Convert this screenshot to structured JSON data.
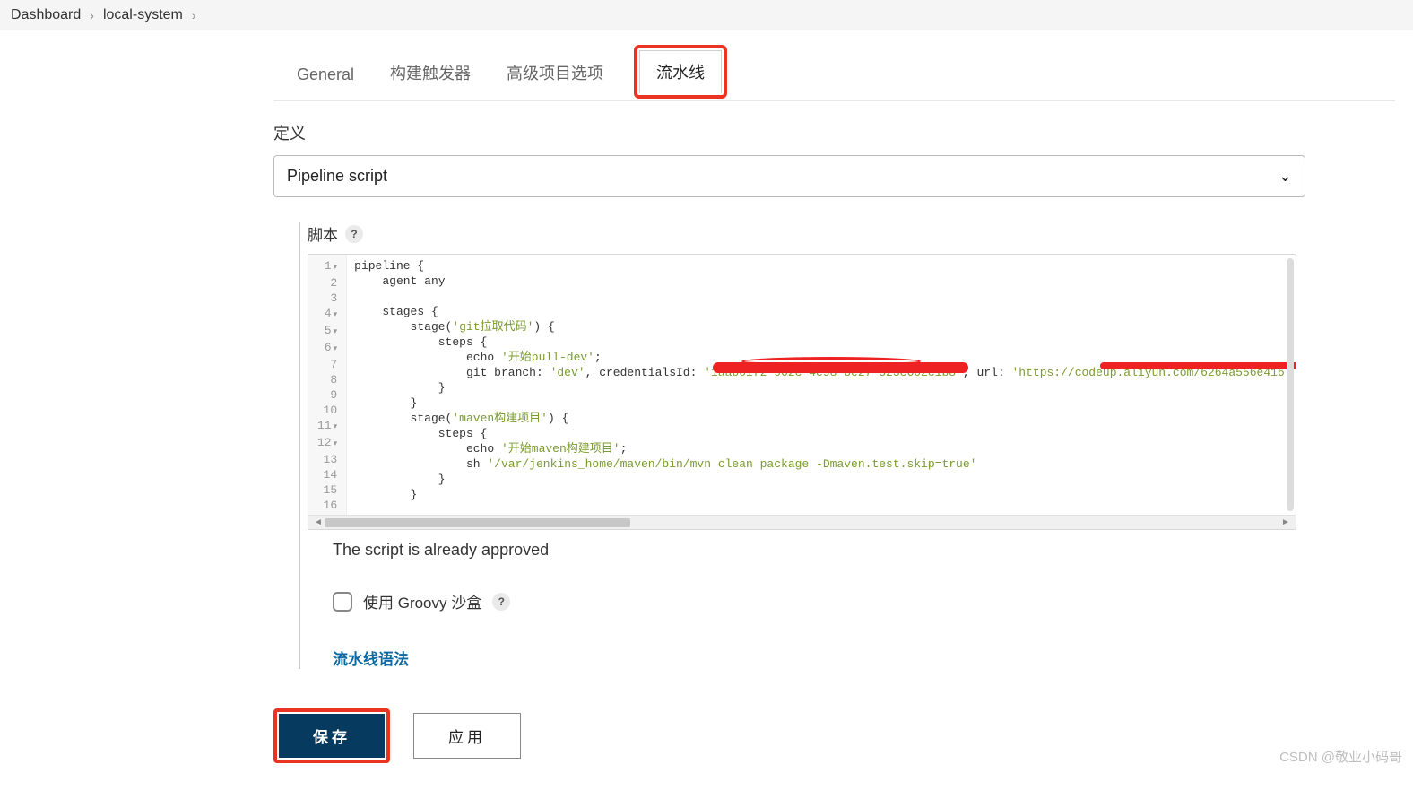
{
  "breadcrumbs": {
    "item0": "Dashboard",
    "item1": "local-system"
  },
  "tabs": {
    "general": "General",
    "triggers": "构建触发器",
    "advanced": "高级项目选项",
    "pipeline": "流水线"
  },
  "definition_label": "定义",
  "definition_select": "Pipeline script",
  "script_label": "脚本",
  "code": {
    "l1": "pipeline {",
    "l2": "    agent any",
    "l3": "",
    "l4": "    stages {",
    "l5": "        stage('git拉取代码') {",
    "l6": "            steps {",
    "l7": "                echo '开始pull-dev';",
    "l8a": "                git branch: ",
    "l8b": "'dev'",
    "l8c": ", credentialsId: ",
    "l8d": "'1aab01f2-962c-4e98-be27-523c602c1b8'",
    "l8e": ", url: ",
    "l8f": "'https://codeup.aliyun.com/6264a556e416",
    "l9": "            }",
    "l10": "        }",
    "l11": "        stage('maven构建项目') {",
    "l12": "            steps {",
    "l13": "                echo '开始maven构建项目';",
    "l14": "                sh '/var/jenkins_home/maven/bin/mvn clean package -Dmaven.test.skip=true'",
    "l15": "            }",
    "l16": "        }",
    "l17": ""
  },
  "approved_text": "The script is already approved",
  "sandbox_label": "使用 Groovy 沙盒",
  "syntax_link": "流水线语法",
  "buttons": {
    "save": "保存",
    "apply": "应用"
  },
  "watermark": "CSDN @敬业小码哥"
}
